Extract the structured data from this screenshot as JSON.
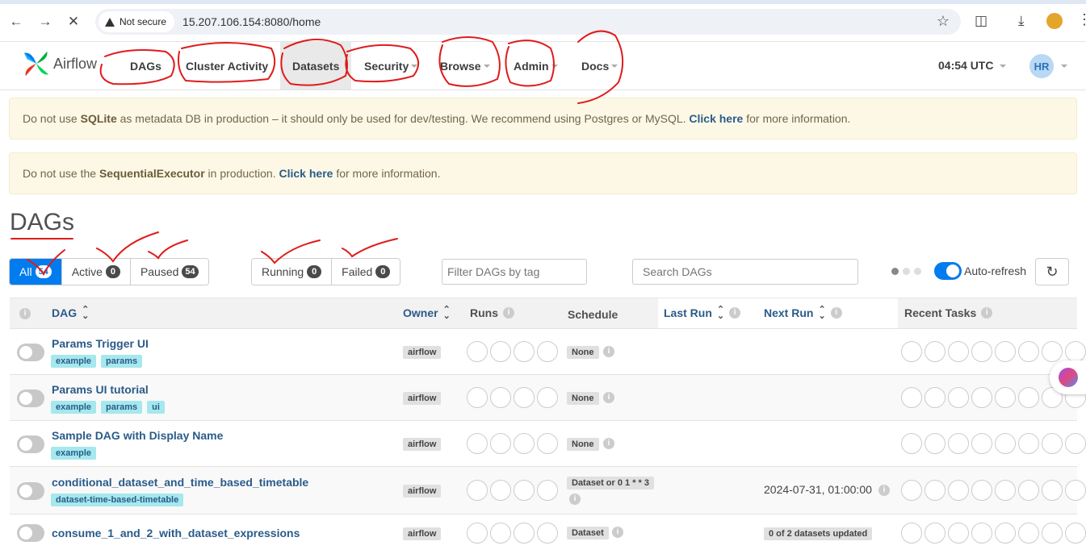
{
  "browser": {
    "security_label": "Not secure",
    "url": "15.207.106.154:8080/home"
  },
  "navbar": {
    "brand": "Airflow",
    "items": [
      {
        "label": "DAGs",
        "dropdown": false
      },
      {
        "label": "Cluster Activity",
        "dropdown": false
      },
      {
        "label": "Datasets",
        "dropdown": false
      },
      {
        "label": "Security",
        "dropdown": true
      },
      {
        "label": "Browse",
        "dropdown": true
      },
      {
        "label": "Admin",
        "dropdown": true
      },
      {
        "label": "Docs",
        "dropdown": true
      }
    ],
    "time": "04:54 UTC",
    "user_initials": "HR"
  },
  "alerts": [
    {
      "pre": "Do not use ",
      "bold": "SQLite",
      "mid": " as metadata DB in production – it should only be used for dev/testing. We recommend using Postgres or MySQL. ",
      "link": "Click here",
      "post": " for more information."
    },
    {
      "pre": "Do not use the ",
      "bold": "SequentialExecutor",
      "mid": " in production. ",
      "link": "Click here",
      "post": " for more information."
    }
  ],
  "page_title": "DAGs",
  "filters": {
    "status": [
      {
        "label": "All",
        "count": "54"
      },
      {
        "label": "Active",
        "count": "0"
      },
      {
        "label": "Paused",
        "count": "54"
      }
    ],
    "run_state": [
      {
        "label": "Running",
        "count": "0"
      },
      {
        "label": "Failed",
        "count": "0"
      }
    ],
    "tag_placeholder": "Filter DAGs by tag",
    "search_placeholder": "Search DAGs",
    "auto_refresh_label": "Auto-refresh"
  },
  "table": {
    "headers": {
      "dag": "DAG",
      "owner": "Owner",
      "runs": "Runs",
      "schedule": "Schedule",
      "last_run": "Last Run",
      "next_run": "Next Run",
      "recent_tasks": "Recent Tasks"
    },
    "rows": [
      {
        "name": "Params Trigger UI",
        "tags": [
          "example",
          "params"
        ],
        "owner": "airflow",
        "schedule": "None",
        "next_run": "",
        "next_run_badge": ""
      },
      {
        "name": "Params UI tutorial",
        "tags": [
          "example",
          "params",
          "ui"
        ],
        "owner": "airflow",
        "schedule": "None",
        "next_run": "",
        "next_run_badge": ""
      },
      {
        "name": "Sample DAG with Display Name",
        "tags": [
          "example"
        ],
        "owner": "airflow",
        "schedule": "None",
        "next_run": "",
        "next_run_badge": ""
      },
      {
        "name": "conditional_dataset_and_time_based_timetable",
        "tags": [
          "dataset-time-based-timetable"
        ],
        "owner": "airflow",
        "schedule": "Dataset or 0 1 * * 3",
        "next_run": "2024-07-31, 01:00:00",
        "next_run_badge": ""
      },
      {
        "name": "consume_1_and_2_with_dataset_expressions",
        "tags": [],
        "owner": "airflow",
        "schedule": "Dataset",
        "next_run": "",
        "next_run_badge": "0 of 2 datasets updated"
      }
    ]
  },
  "colors": {
    "primary": "#017cee",
    "tag_bg": "#a5e8ed",
    "link": "#2a5b8a",
    "alert_bg": "#fcf8e5",
    "annotation": "#e01b1b"
  }
}
